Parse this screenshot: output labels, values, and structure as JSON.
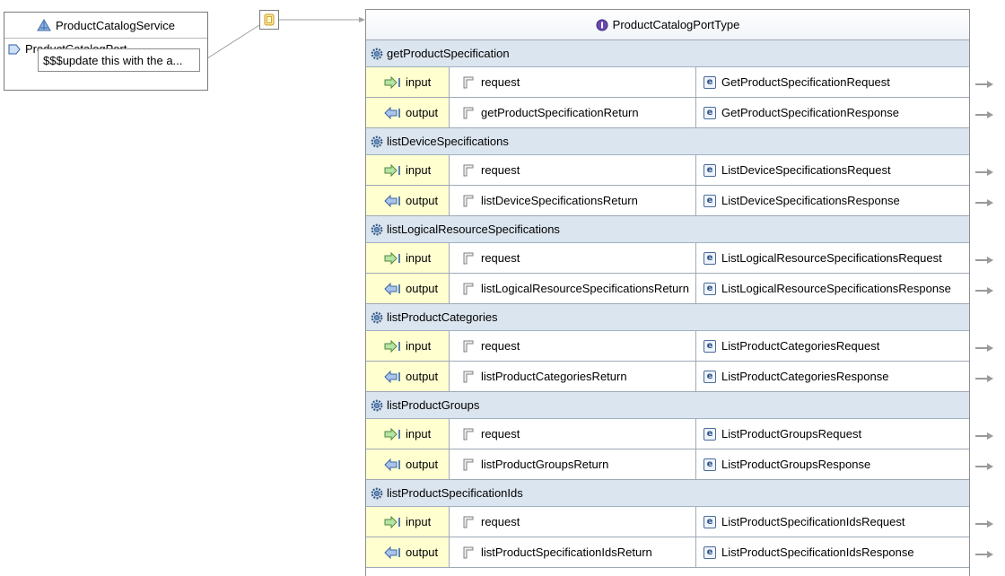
{
  "service": {
    "name": "ProductCatalogService",
    "port": "ProductCatalogPort",
    "address": "$$$update this with the a..."
  },
  "port_type": {
    "name": "ProductCatalogPortType"
  },
  "operations": [
    {
      "name": "getProductSpecification",
      "input": {
        "label": "input",
        "part": "request",
        "element": "GetProductSpecificationRequest"
      },
      "output": {
        "label": "output",
        "part": "getProductSpecificationReturn",
        "element": "GetProductSpecificationResponse"
      }
    },
    {
      "name": "listDeviceSpecifications",
      "input": {
        "label": "input",
        "part": "request",
        "element": "ListDeviceSpecificationsRequest"
      },
      "output": {
        "label": "output",
        "part": "listDeviceSpecificationsReturn",
        "element": "ListDeviceSpecificationsResponse"
      }
    },
    {
      "name": "listLogicalResourceSpecifications",
      "input": {
        "label": "input",
        "part": "request",
        "element": "ListLogicalResourceSpecificationsRequest"
      },
      "output": {
        "label": "output",
        "part": "listLogicalResourceSpecificationsReturn",
        "element": "ListLogicalResourceSpecificationsResponse"
      }
    },
    {
      "name": "listProductCategories",
      "input": {
        "label": "input",
        "part": "request",
        "element": "ListProductCategoriesRequest"
      },
      "output": {
        "label": "output",
        "part": "listProductCategoriesReturn",
        "element": "ListProductCategoriesResponse"
      }
    },
    {
      "name": "listProductGroups",
      "input": {
        "label": "input",
        "part": "request",
        "element": "ListProductGroupsRequest"
      },
      "output": {
        "label": "output",
        "part": "listProductGroupsReturn",
        "element": "ListProductGroupsResponse"
      }
    },
    {
      "name": "listProductSpecificationIds",
      "input": {
        "label": "input",
        "part": "request",
        "element": "ListProductSpecificationIdsRequest"
      },
      "output": {
        "label": "output",
        "part": "listProductSpecificationIdsReturn",
        "element": "ListProductSpecificationIdsResponse"
      }
    }
  ],
  "icons": {
    "service": "service-icon",
    "port": "port-icon",
    "binding": "binding-icon",
    "port_type": "interface-icon",
    "operation": "operation-gear-icon",
    "input": "input-arrow-icon",
    "output": "output-arrow-icon",
    "part": "part-icon",
    "element": "element-icon",
    "link": "link-arrow-icon"
  },
  "colors": {
    "operation_header_bg": "#dbe5ef",
    "io_cell_bg": "#ffffd0",
    "border": "#9fa9b6"
  }
}
